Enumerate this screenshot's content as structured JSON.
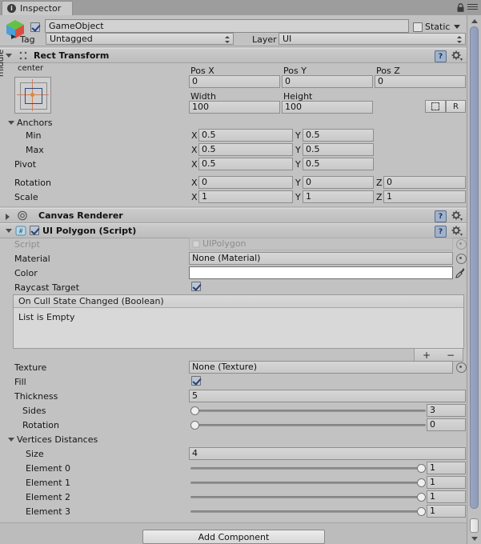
{
  "window": {
    "tab_label": "Inspector",
    "tab_icon": "info-icon",
    "lock_icon": "lock-icon",
    "menu_icon": "hamburger-menu-icon"
  },
  "gameobject": {
    "icon": "gameobject-cube-icon",
    "enabled": true,
    "name": "GameObject",
    "static_label": "Static",
    "static_checked": false,
    "tag_label": "Tag",
    "tag_value": "Untagged",
    "layer_label": "Layer",
    "layer_value": "UI"
  },
  "rect_transform": {
    "title": "Rect Transform",
    "expanded": true,
    "anchor_preset": {
      "horizontal": "center",
      "vertical": "middle"
    },
    "pos": {
      "x_label": "Pos X",
      "x_value": "0",
      "y_label": "Pos Y",
      "y_value": "0",
      "z_label": "Pos Z",
      "z_value": "0"
    },
    "size": {
      "width_label": "Width",
      "width_value": "100",
      "height_label": "Height",
      "height_value": "100"
    },
    "blueprint_button": "blueprint-mode-icon",
    "raw_button": "R",
    "anchors_label": "Anchors",
    "anchors": {
      "min_label": "Min",
      "min_x": "0.5",
      "min_y": "0.5",
      "max_label": "Max",
      "max_x": "0.5",
      "max_y": "0.5"
    },
    "pivot_label": "Pivot",
    "pivot": {
      "x": "0.5",
      "y": "0.5"
    },
    "rotation_label": "Rotation",
    "rotation": {
      "x": "0",
      "y": "0",
      "z": "0"
    },
    "scale_label": "Scale",
    "scale": {
      "x": "1",
      "y": "1",
      "z": "1"
    },
    "axis_x": "X",
    "axis_y": "Y",
    "axis_z": "Z"
  },
  "canvas_renderer": {
    "title": "Canvas Renderer",
    "icon": "canvas-renderer-icon",
    "expanded": false
  },
  "ui_polygon": {
    "title": "UI Polygon (Script)",
    "icon": "script-icon",
    "enabled": true,
    "expanded": true,
    "script_label": "Script",
    "script_value": "UIPolygon",
    "material_label": "Material",
    "material_value": "None (Material)",
    "color_label": "Color",
    "color_value": "#FFFFFF",
    "raycast_label": "Raycast Target",
    "raycast_checked": true,
    "event_title": "On Cull State Changed (Boolean)",
    "event_empty": "List is Empty",
    "event_add": "+",
    "event_remove": "−",
    "texture_label": "Texture",
    "texture_value": "None (Texture)",
    "fill_label": "Fill",
    "fill_checked": true,
    "thickness_label": "Thickness",
    "thickness_value": "5",
    "sides_label": "Sides",
    "sides_value": "3",
    "sides_slider_pct": 0,
    "rotation_label": "Rotation",
    "rotation_value": "0",
    "rotation_slider_pct": 0,
    "vertices_label": "Vertices Distances",
    "vertices_expanded": true,
    "size_label": "Size",
    "size_value": "4",
    "elements": [
      {
        "label": "Element 0",
        "value": "1",
        "slider_pct": 100
      },
      {
        "label": "Element 1",
        "value": "1",
        "slider_pct": 100
      },
      {
        "label": "Element 2",
        "value": "1",
        "slider_pct": 100
      },
      {
        "label": "Element 3",
        "value": "1",
        "slider_pct": 100
      }
    ]
  },
  "footer": {
    "add_component_label": "Add Component"
  },
  "colors": {
    "background": "#c2c2c2",
    "header_gradient_top": "#cbcbcb",
    "checkbox_check": "#2b3f6b",
    "scrollbar_thumb": "#96a3bd",
    "anchor_guide": "#cf7f5e",
    "anchor_pivot": "#e08a2e"
  }
}
